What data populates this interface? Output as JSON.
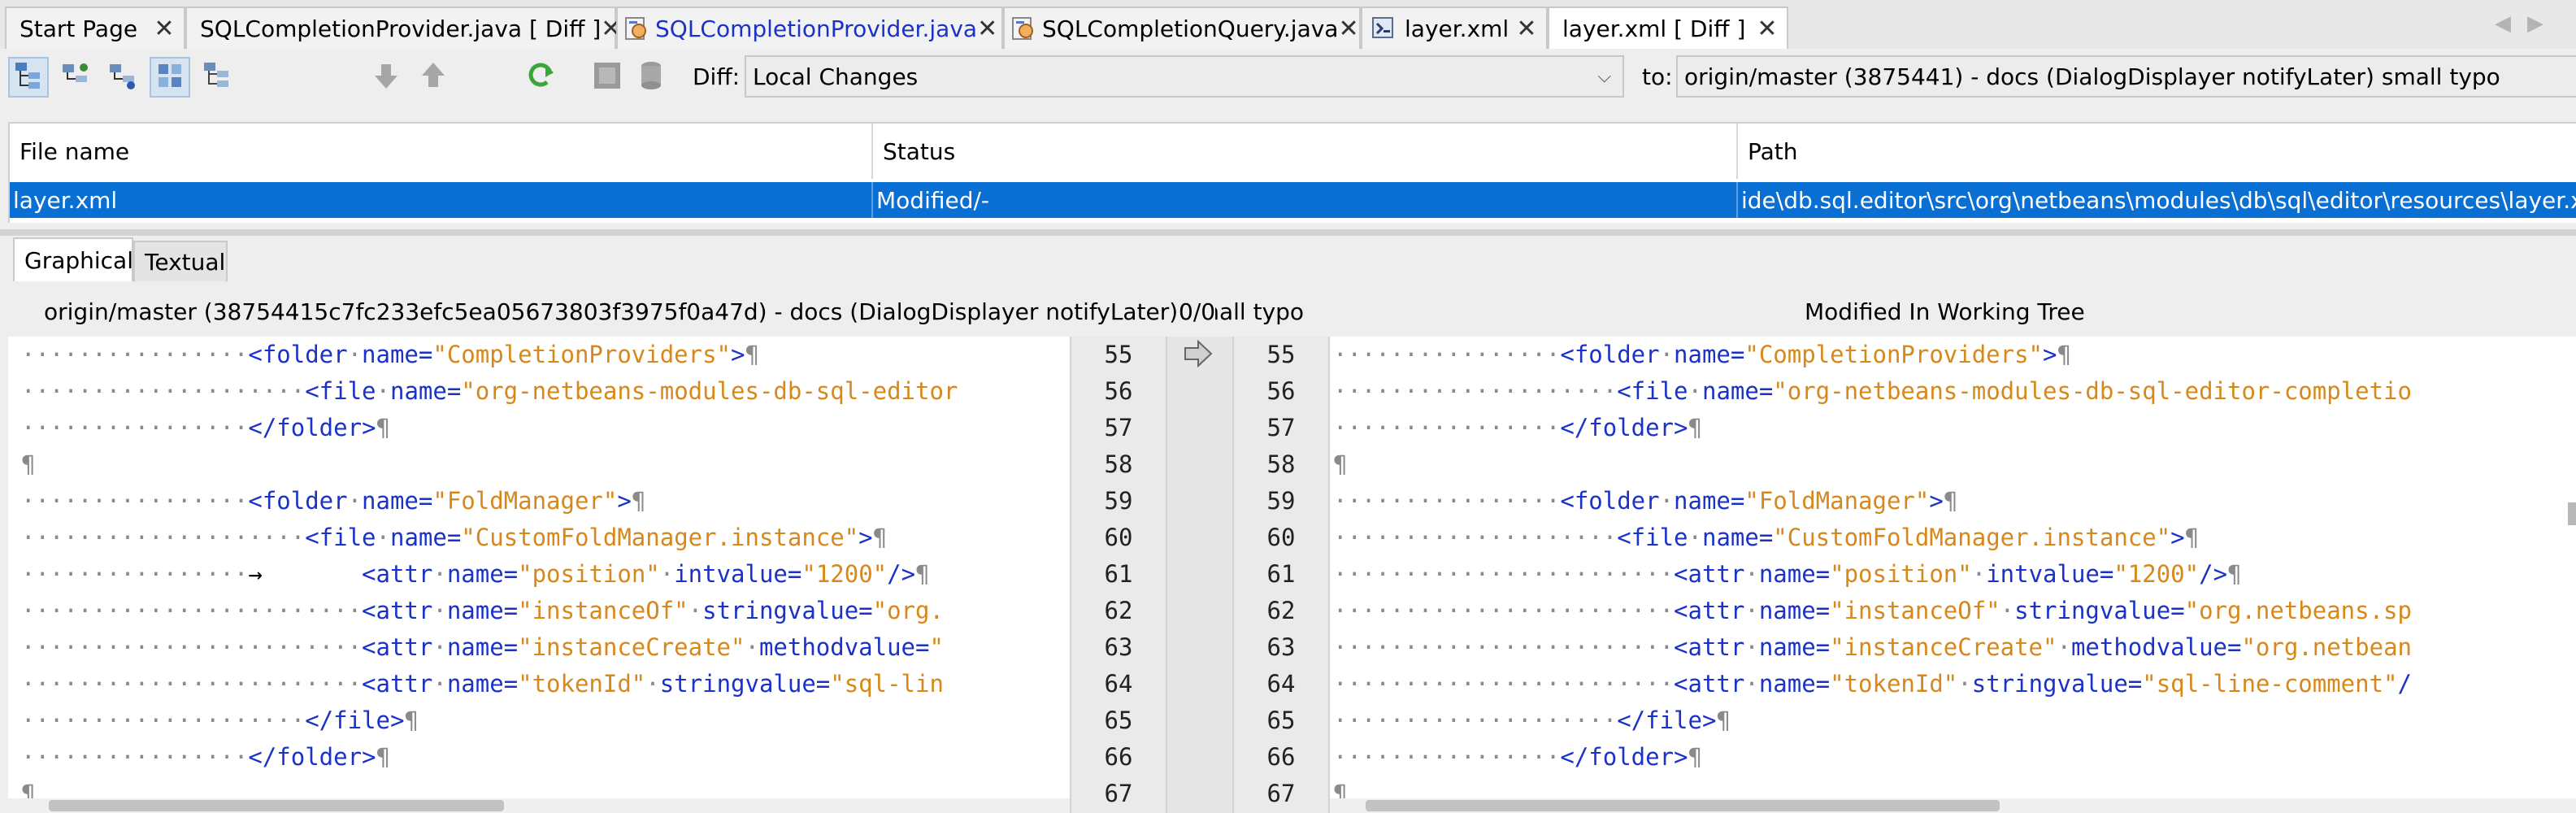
{
  "tabs": [
    {
      "label": "Start Page",
      "icon": "",
      "active": false
    },
    {
      "label": "SQLCompletionProvider.java [ Diff ]",
      "icon": "",
      "active": false
    },
    {
      "label": "SQLCompletionProvider.java",
      "icon": "java-file-icon",
      "active": false,
      "color": "#1b32c8"
    },
    {
      "label": "SQLCompletionQuery.java",
      "icon": "java-file-icon",
      "active": false
    },
    {
      "label": "layer.xml",
      "icon": "xml-layer-icon",
      "active": false
    },
    {
      "label": "layer.xml [ Diff ]",
      "icon": "",
      "active": true
    }
  ],
  "toolbar": {
    "diff_label": "Diff:",
    "diff_value": "Local Changes",
    "to_label": "to:",
    "to_value": "origin/master (3875441) - docs (DialogDisplayer notifyLater) small typo"
  },
  "files_table": {
    "headers": [
      "File name",
      "Status",
      "Path"
    ],
    "rows": [
      {
        "name": "layer.xml",
        "status": "Modified/-",
        "path": "ide\\db.sql.editor\\src\\org\\netbeans\\modules\\db\\sql\\editor\\resources\\layer.xml"
      }
    ]
  },
  "view_tabs": [
    "Graphical",
    "Textual"
  ],
  "diff": {
    "left_title": "origin/master (38754415c7fc233efc5ea05673803f3975f0a47d) - docs (DialogDisplayer notifyLater) small typo",
    "counter": "0/0",
    "right_title": "Modified In Working Tree",
    "line_numbers": [
      "55",
      "56",
      "57",
      "58",
      "59",
      "60",
      "61",
      "62",
      "63",
      "64",
      "65",
      "66",
      "67"
    ]
  },
  "colors": {
    "selection": "#0a6fd2",
    "tag": "#1b32c8",
    "value": "#d8871a"
  }
}
